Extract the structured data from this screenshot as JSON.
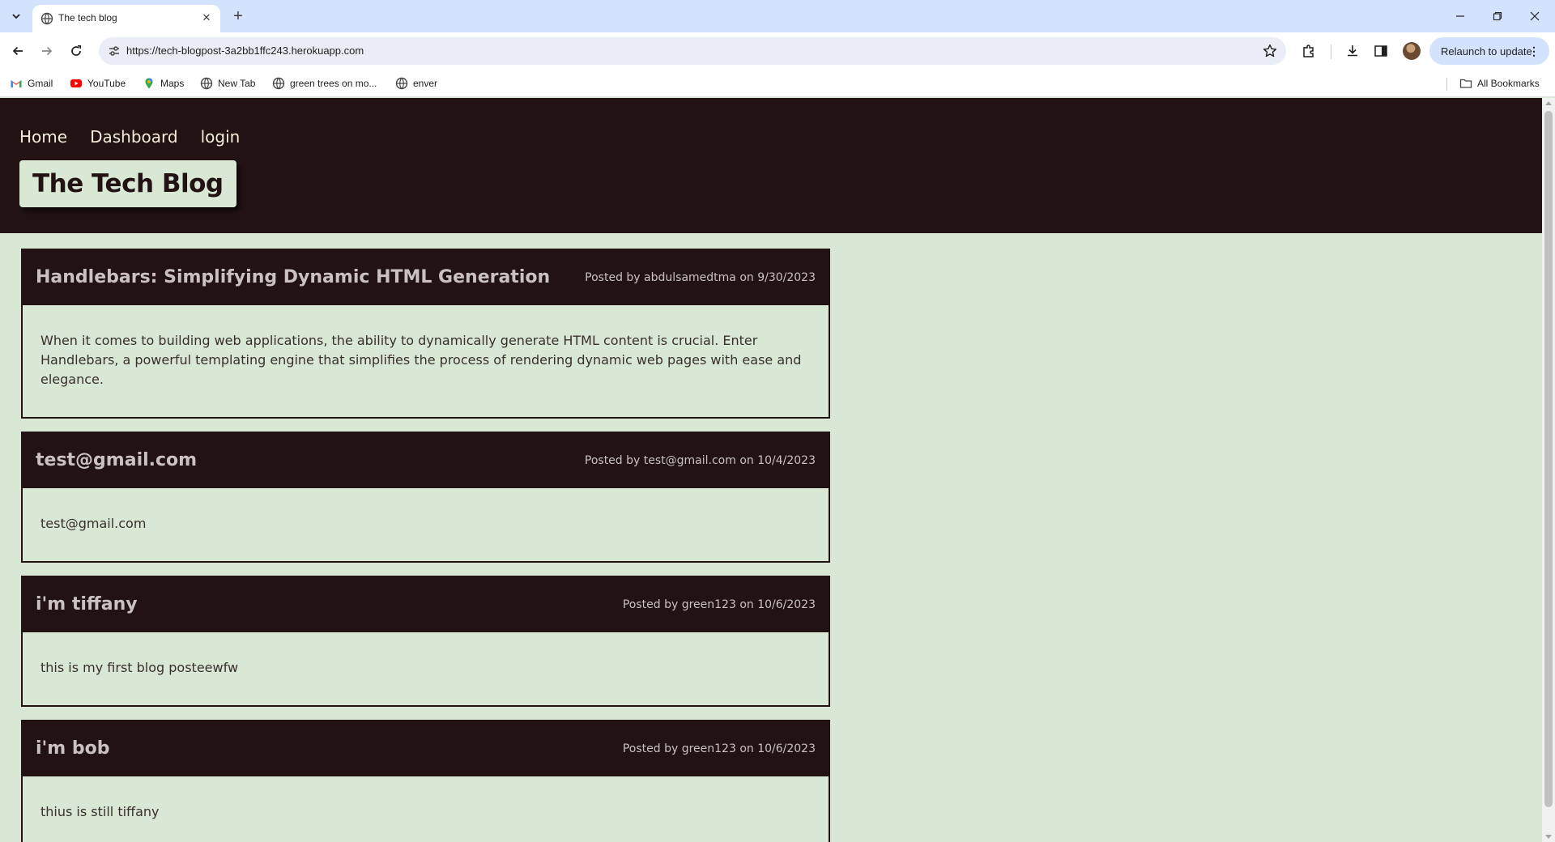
{
  "browser": {
    "tab_title": "The tech blog",
    "url": "https://tech-blogpost-3a2bb1ffc243.herokuapp.com",
    "relaunch_label": "Relaunch to update",
    "bookmarks": [
      {
        "label": "Gmail",
        "icon": "gmail-icon"
      },
      {
        "label": "YouTube",
        "icon": "youtube-icon"
      },
      {
        "label": "Maps",
        "icon": "maps-icon"
      },
      {
        "label": "New Tab",
        "icon": "globe-icon"
      },
      {
        "label": "green trees on mo...",
        "icon": "globe-icon"
      },
      {
        "label": "enver",
        "icon": "globe-icon"
      }
    ],
    "all_bookmarks_label": "All Bookmarks"
  },
  "site": {
    "nav": {
      "home": "Home",
      "dashboard": "Dashboard",
      "login": "login"
    },
    "brand": "The Tech Blog",
    "colors": {
      "header": "#221214",
      "background": "#d9e8d5",
      "nav_text": "#f2ecd9"
    }
  },
  "posts": [
    {
      "title": "Handlebars: Simplifying Dynamic HTML Generation",
      "meta": "Posted by abdulsamedtma on 9/30/2023",
      "body": "When it comes to building web applications, the ability to dynamically generate HTML content is crucial. Enter Handlebars, a powerful templating engine that simplifies the process of rendering dynamic web pages with ease and elegance."
    },
    {
      "title": "test@gmail.com",
      "meta": "Posted by test@gmail.com on 10/4/2023",
      "body": "test@gmail.com"
    },
    {
      "title": "i'm tiffany",
      "meta": "Posted by green123 on 10/6/2023",
      "body": "this is my first blog posteewfw"
    },
    {
      "title": "i'm bob",
      "meta": "Posted by green123 on 10/6/2023",
      "body": "thius is still tiffany"
    }
  ]
}
